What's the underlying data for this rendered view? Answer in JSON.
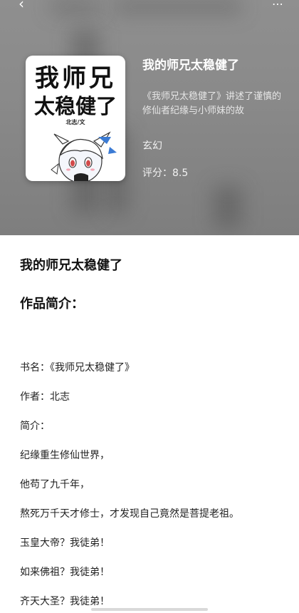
{
  "header": {
    "back_icon": "chevron-left-icon",
    "more_icon": "more-icon"
  },
  "cover": {
    "title_line1": "我师兄",
    "title_line2": "太稳健了",
    "author": "北志/文"
  },
  "hero": {
    "title": "我的师兄太稳健了",
    "description": "《我师兄太稳健了》讲述了谨慎的修仙者纪缘与小师妹的故",
    "genre": "玄幻",
    "rating": "评分：8.5"
  },
  "main": {
    "book_title": "我的师兄太稳健了",
    "section_heading": "作品简介：",
    "lines": [
      "书名：《我师兄太稳健了》",
      "作者：北志",
      "简介：",
      "纪缘重生修仙世界，",
      "他苟了九千年，",
      "熬死万千天才修士，才发现自己竟然是菩提老祖。",
      "玉皇大帝？我徒弟！",
      "如来佛祖？我徒弟！",
      "齐天大圣？我徒弟！"
    ]
  },
  "colors": {
    "hero_bg": "#8a8a8a",
    "text": "#111111",
    "page_bg": "#ffffff"
  }
}
